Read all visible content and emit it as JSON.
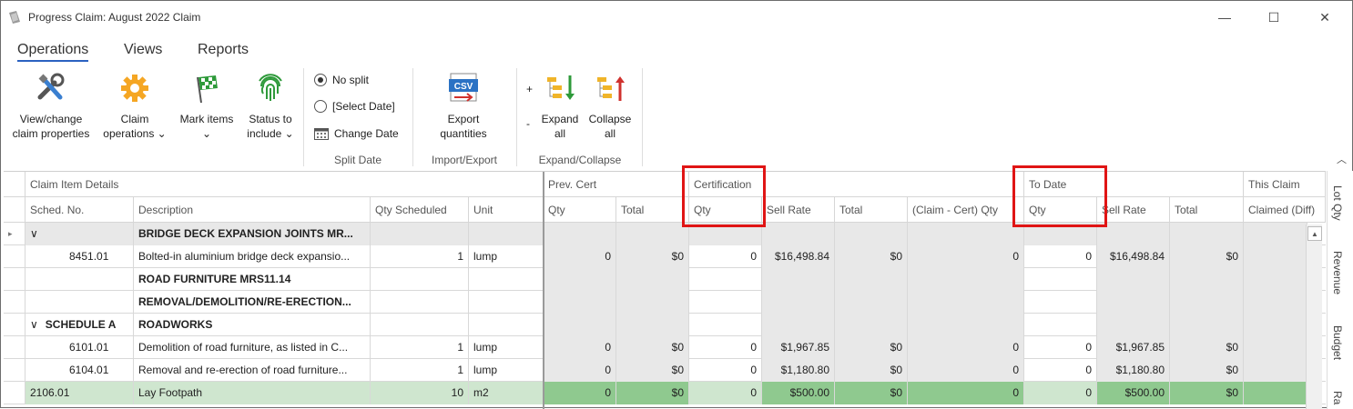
{
  "window": {
    "title": "Progress Claim: August 2022 Claim",
    "minimize": "—",
    "maximize": "☐",
    "close": "✕"
  },
  "tabs": [
    {
      "label": "Operations"
    },
    {
      "label": "Views"
    },
    {
      "label": "Reports"
    }
  ],
  "ribbon": {
    "view_change": "View/change\nclaim properties",
    "claim_ops": "Claim\noperations",
    "mark_items": "Mark items",
    "status": "Status to\ninclude",
    "no_split": "No split",
    "select_date": "[Select Date]",
    "change_date": "Change Date",
    "split_date_group": "Split Date",
    "export_qty": "Export\nquantities",
    "csv": "CSV",
    "import_export_group": "Import/Export",
    "plus": "+",
    "minus": "-",
    "expand_all": "Expand\nall",
    "collapse_all": "Collapse\nall",
    "expand_collapse_group": "Expand/Collapse"
  },
  "grid": {
    "band_headers": {
      "claim_item_details": "Claim Item Details",
      "prev_cert": "Prev. Cert",
      "certification": "Certification",
      "to_date": "To Date",
      "this_claim": "This Claim"
    },
    "columns": {
      "sched_no": "Sched. No.",
      "description": "Description",
      "qty_scheduled": "Qty Scheduled",
      "unit": "Unit",
      "prev_qty": "Qty",
      "prev_total": "Total",
      "cert_qty": "Qty",
      "cert_sell_rate": "Sell Rate",
      "cert_total": "Total",
      "claim_cert_qty": "(Claim - Cert) Qty",
      "td_qty": "Qty",
      "td_sell_rate": "Sell Rate",
      "td_total": "Total",
      "claimed_diff": "Claimed (Diff)"
    },
    "rows": [
      {
        "sched": "",
        "desc": "BRIDGE DECK EXPANSION JOINTS  MR...",
        "qty": "",
        "unit": "",
        "pq": "",
        "pt": "",
        "cq": "",
        "csr": "",
        "ct": "",
        "ccq": "",
        "tq": "",
        "tsr": "",
        "tt": "",
        "cd": "",
        "chev": "∨"
      },
      {
        "sched": "8451.01",
        "desc": "Bolted-in aluminium bridge deck expansio...",
        "qty": "1",
        "unit": "lump",
        "pq": "0",
        "pt": "$0",
        "cq": "0",
        "csr": "$16,498.84",
        "ct": "$0",
        "ccq": "0",
        "tq": "0",
        "tsr": "$16,498.84",
        "tt": "$0",
        "cd": "",
        "chev": ""
      },
      {
        "sched": "",
        "desc": "ROAD FURNITURE  MRS11.14",
        "qty": "",
        "unit": "",
        "pq": "",
        "pt": "",
        "cq": "",
        "csr": "",
        "ct": "",
        "ccq": "",
        "tq": "",
        "tsr": "",
        "tt": "",
        "cd": "",
        "chev": ""
      },
      {
        "sched": "",
        "desc": "REMOVAL/DEMOLITION/RE-ERECTION...",
        "qty": "",
        "unit": "",
        "pq": "",
        "pt": "",
        "cq": "",
        "csr": "",
        "ct": "",
        "ccq": "",
        "tq": "",
        "tsr": "",
        "tt": "",
        "cd": "",
        "chev": ""
      },
      {
        "sched": "SCHEDULE A",
        "desc": "ROADWORKS",
        "qty": "",
        "unit": "",
        "pq": "",
        "pt": "",
        "cq": "",
        "csr": "",
        "ct": "",
        "ccq": "",
        "tq": "",
        "tsr": "",
        "tt": "",
        "cd": "",
        "chev": "∨"
      },
      {
        "sched": "6101.01",
        "desc": "Demolition of road furniture, as listed in C...",
        "qty": "1",
        "unit": "lump",
        "pq": "0",
        "pt": "$0",
        "cq": "0",
        "csr": "$1,967.85",
        "ct": "$0",
        "ccq": "0",
        "tq": "0",
        "tsr": "$1,967.85",
        "tt": "$0",
        "cd": "",
        "chev": ""
      },
      {
        "sched": "6104.01",
        "desc": "Removal and re-erection of road furniture...",
        "qty": "1",
        "unit": "lump",
        "pq": "0",
        "pt": "$0",
        "cq": "0",
        "csr": "$1,180.80",
        "ct": "$0",
        "ccq": "0",
        "tq": "0",
        "tsr": "$1,180.80",
        "tt": "$0",
        "cd": "",
        "chev": ""
      },
      {
        "sched": "2106.01",
        "desc": "Lay Footpath",
        "qty": "10",
        "unit": "m2",
        "pq": "0",
        "pt": "$0",
        "cq": "0",
        "csr": "$500.00",
        "ct": "$0",
        "ccq": "0",
        "tq": "0",
        "tsr": "$500.00",
        "tt": "$0",
        "cd": "",
        "chev": ""
      }
    ]
  },
  "side_tabs": [
    {
      "label": "Lot Qty"
    },
    {
      "label": "Revenue"
    },
    {
      "label": "Budget"
    },
    {
      "label": "Ra"
    }
  ],
  "colors": {
    "highlight_box": "#e01515",
    "selected_row": "#cfe6cf",
    "selected_row_dark": "#8fc98f",
    "active_tab": "#2b62c1"
  }
}
